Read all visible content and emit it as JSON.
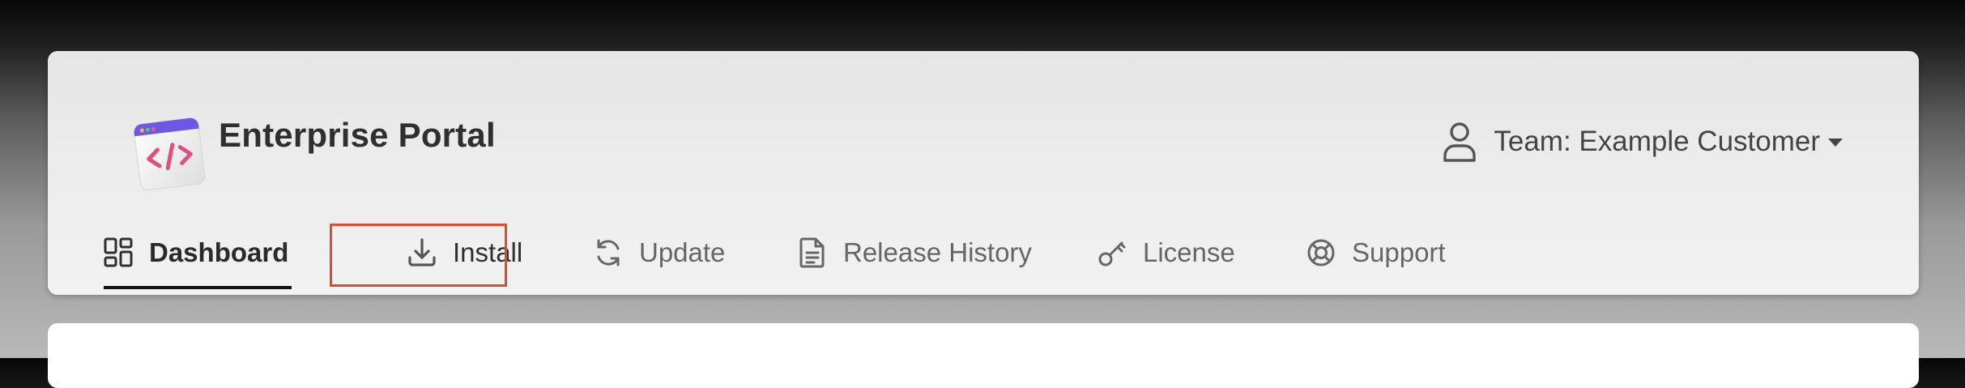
{
  "app": {
    "title": "Enterprise Portal",
    "logo_icon": "code-window-icon"
  },
  "team_menu": {
    "label": "Team: Example Customer",
    "icon": "user-icon",
    "caret_icon": "caret-down-icon"
  },
  "nav": {
    "active": "Dashboard",
    "highlighted": "Install",
    "tabs": [
      {
        "label": "Dashboard",
        "icon": "dashboard-grid-icon"
      },
      {
        "label": "Install",
        "icon": "download-icon"
      },
      {
        "label": "Update",
        "icon": "refresh-icon"
      },
      {
        "label": "Release History",
        "icon": "document-icon"
      },
      {
        "label": "License",
        "icon": "key-icon"
      },
      {
        "label": "Support",
        "icon": "lifebuoy-icon"
      }
    ]
  },
  "colors": {
    "highlight_border": "#e04a2f",
    "logo_purple": "#6f57e6",
    "logo_pink": "#df4f82",
    "active_underline": "#111111"
  }
}
